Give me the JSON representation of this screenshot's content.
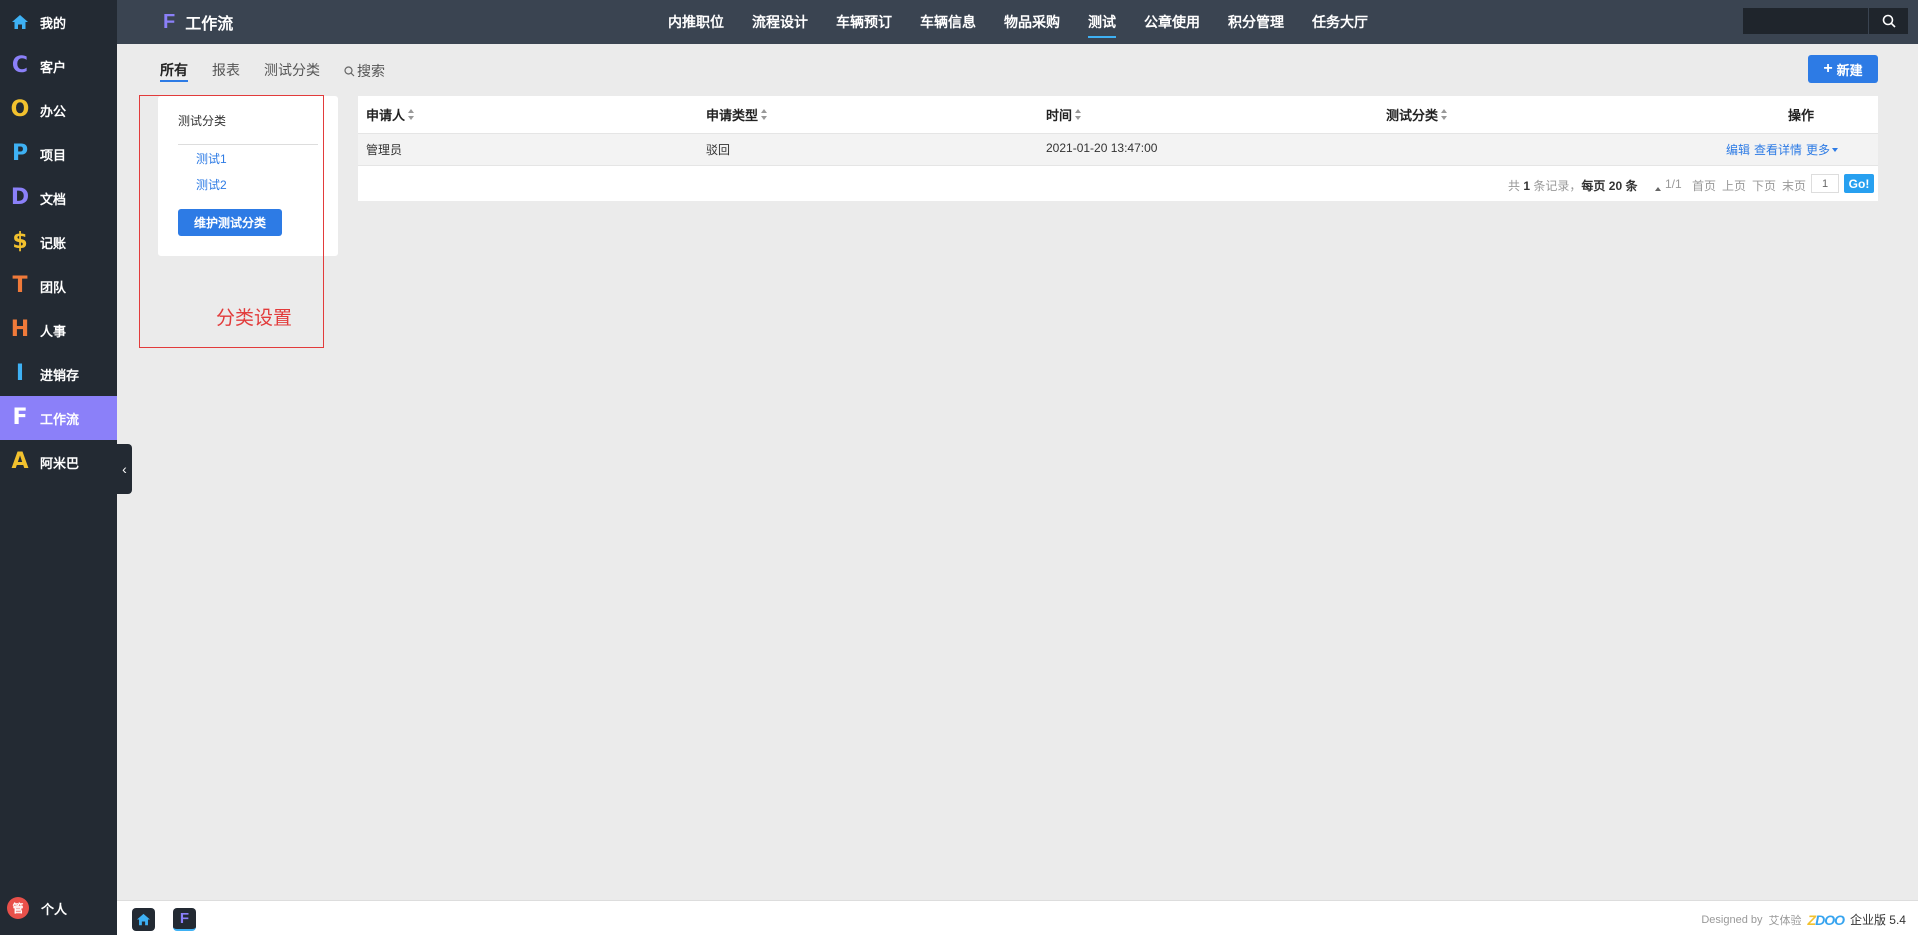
{
  "sidebar": {
    "items": [
      {
        "letter": "",
        "label": "我的",
        "color": "#3eb1f4"
      },
      {
        "letter": "C",
        "label": "客户",
        "color": "#8b80f9"
      },
      {
        "letter": "O",
        "label": "办公",
        "color": "#f2c12e"
      },
      {
        "letter": "P",
        "label": "项目",
        "color": "#3eb1f4"
      },
      {
        "letter": "D",
        "label": "文档",
        "color": "#8b80f9"
      },
      {
        "letter": "$",
        "label": "记账",
        "color": "#f2c12e"
      },
      {
        "letter": "T",
        "label": "团队",
        "color": "#f07a3a"
      },
      {
        "letter": "H",
        "label": "人事",
        "color": "#f07a3a"
      },
      {
        "letter": "I",
        "label": "进销存",
        "color": "#3eb1f4"
      },
      {
        "letter": "F",
        "label": "工作流",
        "color": "#ffffff"
      },
      {
        "letter": "A",
        "label": "阿米巴",
        "color": "#f2c12e"
      }
    ],
    "user": {
      "avatar": "管",
      "label": "个人"
    }
  },
  "topnav": {
    "app_letter": "F",
    "app_title": "工作流",
    "items": [
      "内推职位",
      "流程设计",
      "车辆预订",
      "车辆信息",
      "物品采购",
      "测试",
      "公章使用",
      "积分管理",
      "任务大厅"
    ],
    "active": "测试"
  },
  "subtabs": {
    "all": "所有",
    "report": "报表",
    "category": "测试分类",
    "search": "搜索",
    "new_button": "新建"
  },
  "category_panel": {
    "title": "测试分类",
    "links": [
      "测试1",
      "测试2"
    ],
    "maintain_button": "维护测试分类",
    "annotation": "分类设置"
  },
  "table": {
    "headers": [
      "申请人",
      "申请类型",
      "时间",
      "测试分类",
      "操作"
    ],
    "rows": [
      {
        "applicant": "管理员",
        "type": "驳回",
        "time": "2021-01-20 13:47:00",
        "category": ""
      }
    ],
    "ops": {
      "edit": "编辑",
      "view": "查看详情",
      "more": "更多"
    }
  },
  "pager": {
    "total_prefix": "共",
    "total": "1",
    "total_suffix": "条记录，",
    "per_page_prefix": "每页",
    "per_page": "20",
    "per_page_suffix": "条",
    "pages": "1/1",
    "first": "首页",
    "prev": "上页",
    "next": "下页",
    "last": "末页",
    "page_input": "1",
    "go": "Go!"
  },
  "footer": {
    "designed_by": "Designed by",
    "designer": "艾体验",
    "brand_z": "Z",
    "brand_doo": "DOO",
    "edition": "企业版 5.4"
  }
}
